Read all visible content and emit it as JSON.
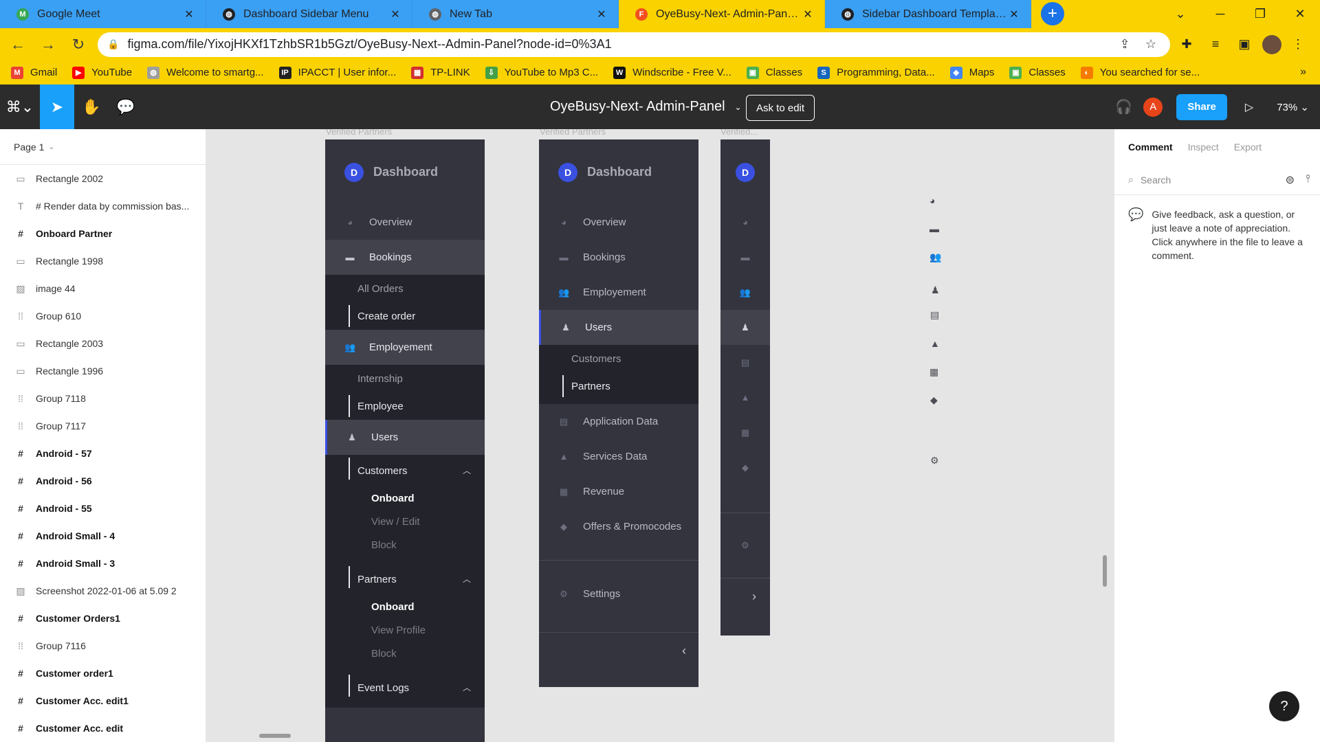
{
  "browser": {
    "tabs": [
      {
        "title": "Google Meet",
        "favicon_color": "#34a853",
        "favicon_glyph": "M"
      },
      {
        "title": "Dashboard Sidebar Menu",
        "favicon_color": "#202124",
        "favicon_glyph": "◍"
      },
      {
        "title": "New Tab",
        "favicon_color": "#5f6368",
        "favicon_glyph": "◍"
      },
      {
        "title": "OyeBusy-Next- Admin-Panel – Fi",
        "favicon_color": "#f24e1e",
        "favicon_glyph": "F"
      },
      {
        "title": "Sidebar Dashboard Template Wit",
        "favicon_color": "#202124",
        "favicon_glyph": "◍"
      }
    ],
    "url": "figma.com/file/YixojHKXf1TzhbSR1b5Gzt/OyeBusy-Next--Admin-Panel?node-id=0%3A1",
    "bookmarks": [
      {
        "label": "Gmail",
        "color": "#ea4335",
        "glyph": "M"
      },
      {
        "label": "YouTube",
        "color": "#ff0000",
        "glyph": "▶"
      },
      {
        "label": "Welcome to smartg...",
        "color": "#9e9e9e",
        "glyph": "◍"
      },
      {
        "label": "IPACCT | User infor...",
        "color": "#222222",
        "glyph": "IP"
      },
      {
        "label": "TP-LINK",
        "color": "#d32f2f",
        "glyph": "▦"
      },
      {
        "label": "YouTube to Mp3 C...",
        "color": "#43a047",
        "glyph": "⇩"
      },
      {
        "label": "Windscribe - Free V...",
        "color": "#111111",
        "glyph": "W"
      },
      {
        "label": "Classes",
        "color": "#4caf50",
        "glyph": "▣"
      },
      {
        "label": "Programming, Data...",
        "color": "#1565c0",
        "glyph": "S"
      },
      {
        "label": "Maps",
        "color": "#4285f4",
        "glyph": "◆"
      },
      {
        "label": "Classes",
        "color": "#4caf50",
        "glyph": "▣"
      },
      {
        "label": "You searched for se...",
        "color": "#f57c00",
        "glyph": "◐"
      }
    ],
    "bookmarks_more": "»"
  },
  "figma": {
    "file_title": "OyeBusy-Next- Admin-Panel",
    "ask_to_edit": "Ask to edit",
    "user_initial": "A",
    "share": "Share",
    "zoom": "73%",
    "page": "Page 1"
  },
  "layers": [
    {
      "name": "Rectangle 2002",
      "type": "rect"
    },
    {
      "name": "# Render data by commission bas...",
      "type": "text"
    },
    {
      "name": "Onboard Partner",
      "type": "frame"
    },
    {
      "name": "Rectangle 1998",
      "type": "rect"
    },
    {
      "name": "image 44",
      "type": "image"
    },
    {
      "name": "Group 610",
      "type": "group"
    },
    {
      "name": "Rectangle 2003",
      "type": "rect"
    },
    {
      "name": "Rectangle 1996",
      "type": "rect"
    },
    {
      "name": "Group 7118",
      "type": "group"
    },
    {
      "name": "Group 7117",
      "type": "group"
    },
    {
      "name": "Android - 57",
      "type": "frame"
    },
    {
      "name": "Android - 56",
      "type": "frame"
    },
    {
      "name": "Android - 55",
      "type": "frame"
    },
    {
      "name": "Android Small - 4",
      "type": "frame"
    },
    {
      "name": "Android Small - 3",
      "type": "frame"
    },
    {
      "name": "Screenshot 2022-01-06 at 5.09 2",
      "type": "image"
    },
    {
      "name": "Customer Orders1",
      "type": "frame"
    },
    {
      "name": "Group 7116",
      "type": "group"
    },
    {
      "name": "Customer order1",
      "type": "frame"
    },
    {
      "name": "Customer Acc. edit1",
      "type": "frame"
    },
    {
      "name": "Customer Acc. edit",
      "type": "frame"
    }
  ],
  "canvas": {
    "frame_label_1": "Verified Partners",
    "frame_label_2": "Verified Partners",
    "frame_label_3": "Verified...",
    "brand": "Dashboard",
    "brand_initial": "D",
    "panel1": {
      "overview": "Overview",
      "bookings": "Bookings",
      "all_orders": "All Orders",
      "create_order": "Create order",
      "employement": "Employement",
      "internship": "Internship",
      "employee": "Employee",
      "users": "Users",
      "customers": "Customers",
      "onboard_1": "Onboard",
      "view_edit": "View / Edit",
      "block_1": "Block",
      "partners": "Partners",
      "onboard_2": "Onboard",
      "view_profile": "View Profile",
      "block_2": "Block",
      "event_logs": "Event Logs"
    },
    "panel2": {
      "overview": "Overview",
      "bookings": "Bookings",
      "employement": "Employement",
      "users": "Users",
      "customers": "Customers",
      "partners": "Partners",
      "application_data": "Application Data",
      "services_data": "Services Data",
      "revenue": "Revenue",
      "offers": "Offers & Promocodes",
      "settings": "Settings"
    }
  },
  "comments": {
    "tabs": [
      "Comment",
      "Inspect",
      "Export"
    ],
    "search_placeholder": "Search",
    "hint": "Give feedback, ask a question, or just leave a note of appreciation. Click anywhere in the file to leave a comment.",
    "help": "?"
  }
}
